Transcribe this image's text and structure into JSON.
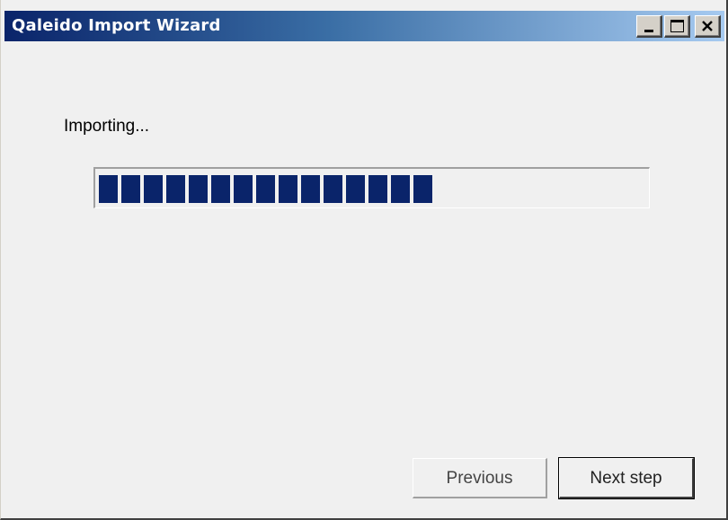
{
  "window": {
    "title": "Qaleido Import Wizard",
    "title_gradient": [
      "#0a246a",
      "#3a6ea5",
      "#a6caf0"
    ],
    "caption_buttons": [
      "minimize-icon",
      "maximize-icon",
      "close-icon"
    ]
  },
  "main": {
    "status_label": "Importing...",
    "progress": {
      "value": 0.63,
      "color": "#0a246a"
    }
  },
  "footer": {
    "previous_label": "Previous",
    "next_label": "Next step",
    "previous_enabled": false
  }
}
